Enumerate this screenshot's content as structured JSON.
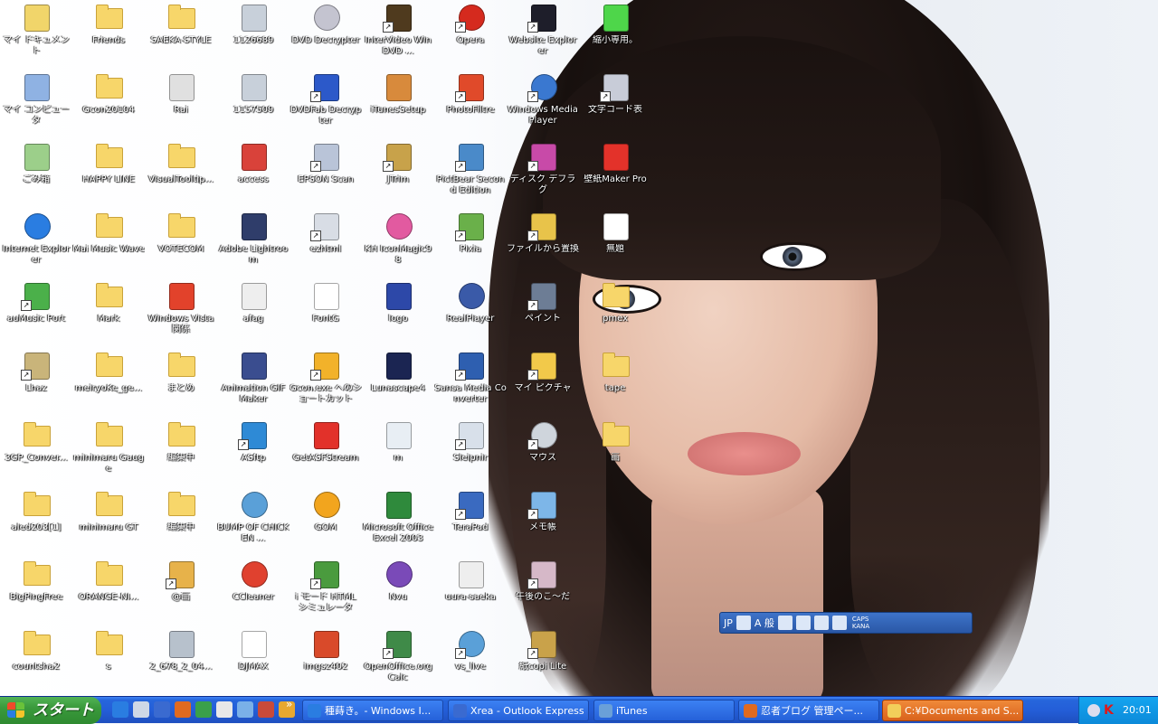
{
  "desktop": {
    "icons": [
      {
        "col": 0,
        "row": 0,
        "label": "マイ ドキュメント",
        "type": "app",
        "color": "#f1d56a"
      },
      {
        "col": 0,
        "row": 1,
        "label": "マイ コンピュータ",
        "type": "app",
        "color": "#8fb2e3"
      },
      {
        "col": 0,
        "row": 2,
        "label": "ごみ箱",
        "type": "app",
        "color": "#9ccf8a"
      },
      {
        "col": 0,
        "row": 3,
        "label": "Internet Explorer",
        "type": "round",
        "color": "#2a7de1"
      },
      {
        "col": 0,
        "row": 4,
        "label": "auMusic Port",
        "type": "app",
        "color": "#4bb04a",
        "shortcut": true
      },
      {
        "col": 0,
        "row": 5,
        "label": "Lhaz",
        "type": "app",
        "color": "#c9b47a",
        "shortcut": true
      },
      {
        "col": 0,
        "row": 6,
        "label": "3GP_Conver...",
        "type": "folder"
      },
      {
        "col": 0,
        "row": 7,
        "label": "aled203[1]",
        "type": "folder"
      },
      {
        "col": 0,
        "row": 8,
        "label": "BigPingFree",
        "type": "folder"
      },
      {
        "col": 0,
        "row": 9,
        "label": "countsha2",
        "type": "folder"
      },
      {
        "col": 1,
        "row": 0,
        "label": "Friends",
        "type": "folder"
      },
      {
        "col": 1,
        "row": 1,
        "label": "Gcon20104",
        "type": "folder"
      },
      {
        "col": 1,
        "row": 2,
        "label": "HAPPY LINE",
        "type": "folder"
      },
      {
        "col": 1,
        "row": 3,
        "label": "Mai Music Wave",
        "type": "folder"
      },
      {
        "col": 1,
        "row": 4,
        "label": "Mark",
        "type": "folder"
      },
      {
        "col": 1,
        "row": 5,
        "label": "meiryoKe_ge...",
        "type": "folder"
      },
      {
        "col": 1,
        "row": 6,
        "label": "minimaru Gauge",
        "type": "folder"
      },
      {
        "col": 1,
        "row": 7,
        "label": "minimaru GT",
        "type": "folder"
      },
      {
        "col": 1,
        "row": 8,
        "label": "ORANGE-NI...",
        "type": "folder"
      },
      {
        "col": 1,
        "row": 9,
        "label": "s",
        "type": "folder"
      },
      {
        "col": 2,
        "row": 0,
        "label": "SAEKA-STYLE",
        "type": "folder"
      },
      {
        "col": 2,
        "row": 1,
        "label": "Rai",
        "type": "app",
        "color": "#e0e0e0"
      },
      {
        "col": 2,
        "row": 2,
        "label": "VisualTooltip...",
        "type": "folder"
      },
      {
        "col": 2,
        "row": 3,
        "label": "VOTECOM",
        "type": "folder"
      },
      {
        "col": 2,
        "row": 4,
        "label": "Windows Vista 関係",
        "type": "app",
        "color": "#e2422b"
      },
      {
        "col": 2,
        "row": 5,
        "label": "まとめ",
        "type": "folder"
      },
      {
        "col": 2,
        "row": 6,
        "label": "編集中",
        "type": "folder"
      },
      {
        "col": 2,
        "row": 7,
        "label": "編集中",
        "type": "folder"
      },
      {
        "col": 2,
        "row": 8,
        "label": "@画",
        "type": "app",
        "color": "#e7b24a",
        "shortcut": true
      },
      {
        "col": 2,
        "row": 9,
        "label": "2_678_2_04...",
        "type": "app",
        "color": "#b7c1cc"
      },
      {
        "col": 3,
        "row": 0,
        "label": "1126689",
        "type": "app",
        "color": "#c8d0da"
      },
      {
        "col": 3,
        "row": 1,
        "label": "1157509",
        "type": "app",
        "color": "#c8d0da"
      },
      {
        "col": 3,
        "row": 2,
        "label": "access",
        "type": "app",
        "color": "#d9423a"
      },
      {
        "col": 3,
        "row": 3,
        "label": "Adobe Lightroom",
        "type": "app",
        "color": "#2f3d6a"
      },
      {
        "col": 3,
        "row": 4,
        "label": "afag",
        "type": "app",
        "color": "#eeeeee"
      },
      {
        "col": 3,
        "row": 5,
        "label": "Animation GIF Maker",
        "type": "app",
        "color": "#3a4d8f"
      },
      {
        "col": 3,
        "row": 6,
        "label": "ASftp",
        "type": "app",
        "color": "#2e8ad6",
        "shortcut": true
      },
      {
        "col": 3,
        "row": 7,
        "label": "BUMP OF CHICKEN ...",
        "type": "round",
        "color": "#5aa0d8"
      },
      {
        "col": 3,
        "row": 8,
        "label": "CCleaner",
        "type": "round",
        "color": "#e0412f"
      },
      {
        "col": 3,
        "row": 9,
        "label": "DJMAX",
        "type": "app",
        "color": "#ffffff"
      },
      {
        "col": 4,
        "row": 0,
        "label": "DVD Decrypter",
        "type": "round",
        "color": "#c4c4d0"
      },
      {
        "col": 4,
        "row": 1,
        "label": "DVDFab Decrypter",
        "type": "app",
        "color": "#2c59c9",
        "shortcut": true
      },
      {
        "col": 4,
        "row": 2,
        "label": "EPSON Scan",
        "type": "app",
        "color": "#b9c4d8",
        "shortcut": true
      },
      {
        "col": 4,
        "row": 3,
        "label": "ezhtml",
        "type": "app",
        "color": "#d8dde5",
        "shortcut": true
      },
      {
        "col": 4,
        "row": 4,
        "label": "FontG",
        "type": "app",
        "color": "#ffffff"
      },
      {
        "col": 4,
        "row": 5,
        "label": "Gcon.exe へのショートカット",
        "type": "app",
        "color": "#f2b22a",
        "shortcut": true
      },
      {
        "col": 4,
        "row": 6,
        "label": "GetASFStream",
        "type": "app",
        "color": "#e2312a"
      },
      {
        "col": 4,
        "row": 7,
        "label": "GOM",
        "type": "round",
        "color": "#f2a51e"
      },
      {
        "col": 4,
        "row": 8,
        "label": "i モード HTML シミュレータ",
        "type": "app",
        "color": "#4a9b3e",
        "shortcut": true
      },
      {
        "col": 4,
        "row": 9,
        "label": "imgsz402",
        "type": "app",
        "color": "#d94a2a"
      },
      {
        "col": 5,
        "row": 0,
        "label": "InterVideo WinDVD ...",
        "type": "app",
        "color": "#4f3a1e",
        "shortcut": true
      },
      {
        "col": 5,
        "row": 1,
        "label": "iTunesSetup",
        "type": "app",
        "color": "#d88a3c"
      },
      {
        "col": 5,
        "row": 2,
        "label": "JTrim",
        "type": "app",
        "color": "#c8a24a",
        "shortcut": true
      },
      {
        "col": 5,
        "row": 3,
        "label": "KH IconMagic98",
        "type": "round",
        "color": "#e25aa0"
      },
      {
        "col": 5,
        "row": 4,
        "label": "logo",
        "type": "app",
        "color": "#2d48a8"
      },
      {
        "col": 5,
        "row": 5,
        "label": "Lunascape4",
        "type": "app",
        "color": "#1b2552"
      },
      {
        "col": 5,
        "row": 6,
        "label": "m",
        "type": "app",
        "color": "#e8eef4"
      },
      {
        "col": 5,
        "row": 7,
        "label": "Microsoft Office Excel 2003",
        "type": "app",
        "color": "#2f8a3c"
      },
      {
        "col": 5,
        "row": 8,
        "label": "Nvu",
        "type": "round",
        "color": "#7a4ab8"
      },
      {
        "col": 5,
        "row": 9,
        "label": "OpenOffice.org Calc",
        "type": "app",
        "color": "#3f8a48",
        "shortcut": true
      },
      {
        "col": 6,
        "row": 0,
        "label": "Opera",
        "type": "round",
        "color": "#d52a1e",
        "shortcut": true
      },
      {
        "col": 6,
        "row": 1,
        "label": "PhotoFiltre",
        "type": "app",
        "color": "#e04a2a",
        "shortcut": true
      },
      {
        "col": 6,
        "row": 2,
        "label": "PictBear Second Edition",
        "type": "app",
        "color": "#4a8ac9",
        "shortcut": true
      },
      {
        "col": 6,
        "row": 3,
        "label": "Pixia",
        "type": "app",
        "color": "#6ab04a",
        "shortcut": true
      },
      {
        "col": 6,
        "row": 4,
        "label": "RealPlayer",
        "type": "round",
        "color": "#3a5aa8"
      },
      {
        "col": 6,
        "row": 5,
        "label": "Sansa Media Converter",
        "type": "app",
        "color": "#2e5fb0",
        "shortcut": true
      },
      {
        "col": 6,
        "row": 6,
        "label": "Sleipnir",
        "type": "app",
        "color": "#d8e0ea",
        "shortcut": true
      },
      {
        "col": 6,
        "row": 7,
        "label": "TeraPad",
        "type": "app",
        "color": "#3a6ac0",
        "shortcut": true
      },
      {
        "col": 6,
        "row": 8,
        "label": "uura-saeka",
        "type": "app",
        "color": "#eeeeee"
      },
      {
        "col": 6,
        "row": 9,
        "label": "vs_live",
        "type": "round",
        "color": "#5aa0d8",
        "shortcut": true
      },
      {
        "col": 7,
        "row": 0,
        "label": "Website Explorer",
        "type": "app",
        "color": "#1e1e2a",
        "shortcut": true
      },
      {
        "col": 7,
        "row": 1,
        "label": "Windows Media Player",
        "type": "round",
        "color": "#3a78d0",
        "shortcut": true
      },
      {
        "col": 7,
        "row": 2,
        "label": "ディスク デフラグ",
        "type": "app",
        "color": "#c84aa8",
        "shortcut": true
      },
      {
        "col": 7,
        "row": 3,
        "label": "ファイルから置換",
        "type": "app",
        "color": "#e8c34a",
        "shortcut": true
      },
      {
        "col": 7,
        "row": 4,
        "label": "ペイント",
        "type": "app",
        "color": "#6d7d95",
        "shortcut": true
      },
      {
        "col": 7,
        "row": 5,
        "label": "マイ ピクチャ",
        "type": "app",
        "color": "#f2c94a",
        "shortcut": true
      },
      {
        "col": 7,
        "row": 6,
        "label": "マウス",
        "type": "round",
        "color": "#cfd5dc",
        "shortcut": true
      },
      {
        "col": 7,
        "row": 7,
        "label": "メモ帳",
        "type": "app",
        "color": "#7db6e8",
        "shortcut": true
      },
      {
        "col": 7,
        "row": 8,
        "label": "午後のこ～だ",
        "type": "app",
        "color": "#d6b8c8",
        "shortcut": true
      },
      {
        "col": 7,
        "row": 9,
        "label": "紙copi Lite",
        "type": "app",
        "color": "#c9a24a",
        "shortcut": true
      },
      {
        "col": 8,
        "row": 0,
        "label": "縮小専用。",
        "type": "app",
        "color": "#4ed64a"
      },
      {
        "col": 8,
        "row": 1,
        "label": "文字コード表",
        "type": "app",
        "color": "#c8ccd8",
        "shortcut": true
      },
      {
        "col": 8,
        "row": 2,
        "label": "壁紙Maker Pro",
        "type": "app",
        "color": "#e3322a"
      },
      {
        "col": 8,
        "row": 3,
        "label": "無題",
        "type": "app",
        "color": "#ffffff"
      },
      {
        "col": 8,
        "row": 4,
        "label": "pmex",
        "type": "folder"
      },
      {
        "col": 8,
        "row": 5,
        "label": "tape",
        "type": "folder"
      },
      {
        "col": 8,
        "row": 6,
        "label": "画",
        "type": "folder"
      }
    ]
  },
  "langbar": {
    "lang": "JP",
    "mode": "A 般",
    "caps": "CAPS",
    "kana": "KANA"
  },
  "taskbar": {
    "start_label": "スタート",
    "more": "»",
    "quicklaunch_colors": [
      "#2a7de1",
      "#cfd8e6",
      "#3a6ad0",
      "#e06a20",
      "#3aa04a",
      "#e8e8e8",
      "#7ab0e8",
      "#c84a3a",
      "#e8a830"
    ],
    "tasks": [
      {
        "label": "種蒔き。- Windows I...",
        "icon_color": "#2a7de1",
        "active": false
      },
      {
        "label": "Xrea - Outlook Express",
        "icon_color": "#3a6ad0",
        "active": false
      },
      {
        "label": "iTunes",
        "icon_color": "#6aa0d8",
        "active": false
      },
      {
        "label": "忍者ブログ 管理ペー...",
        "icon_color": "#e06a20",
        "active": false
      },
      {
        "label": "C:¥Documents and S...",
        "icon_color": "#f2cf5a",
        "active": true
      }
    ],
    "clock": "20:01"
  }
}
